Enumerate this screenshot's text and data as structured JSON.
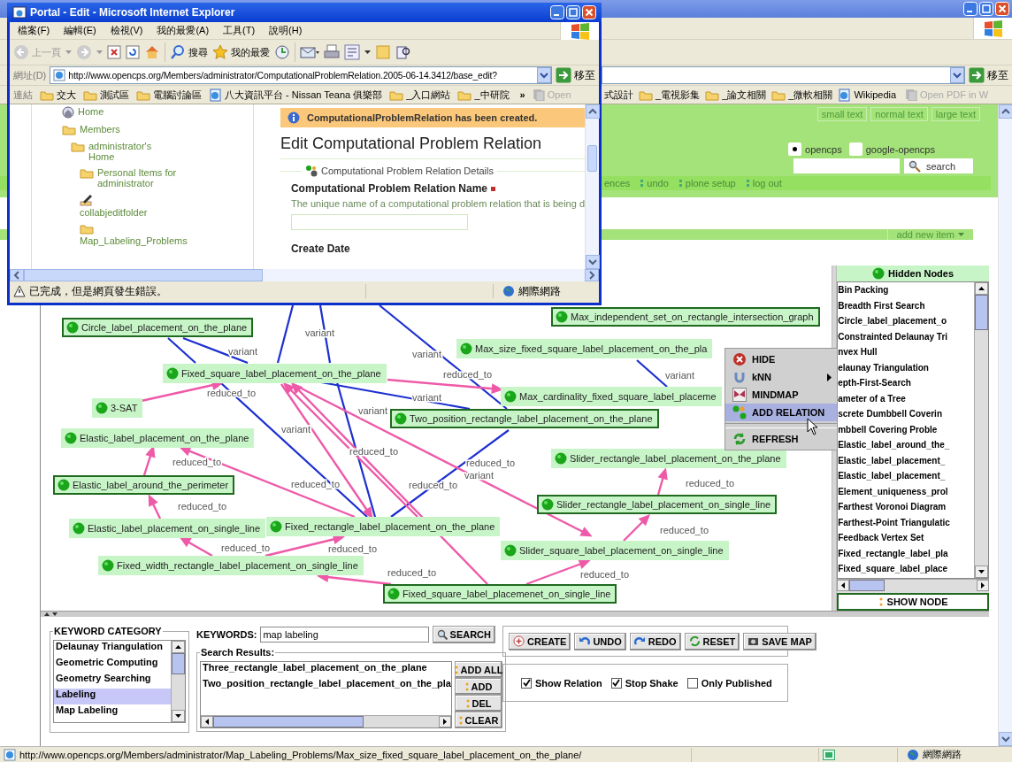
{
  "main_window": {
    "links": [
      {
        "label": "式設計",
        "kind": "folder_cut"
      },
      {
        "label": "_電視影集",
        "kind": "folder"
      },
      {
        "label": "_論文相關",
        "kind": "folder"
      },
      {
        "label": "_微軟相關",
        "kind": "folder"
      },
      {
        "label": "Wikipedia",
        "kind": "page"
      },
      {
        "label": "Open PDF in W",
        "kind": "disabled"
      }
    ],
    "go_button": "移至",
    "page": {
      "text_sizes": [
        "small text",
        "normal text",
        "large text"
      ],
      "search_scopes": [
        {
          "label": "opencps",
          "selected": true
        },
        {
          "label": "google-opencps",
          "selected": false
        }
      ],
      "search_button": "search",
      "nav_items": [
        "ences",
        "undo",
        "plone setup",
        "log out"
      ],
      "add_menu": "add new item"
    },
    "status_bar": {
      "url": "http://www.opencps.org/Members/administrator/Map_Labeling_Problems/Max_size_fixed_square_label_placement_on_the_plane/",
      "zone": "網際網路"
    }
  },
  "popup_window": {
    "title": "Portal - Edit - Microsoft Internet Explorer",
    "menu": [
      "檔案(F)",
      "編輯(E)",
      "檢視(V)",
      "我的最愛(A)",
      "工具(T)",
      "說明(H)"
    ],
    "toolbar": [
      {
        "label": "上一頁",
        "disabled": true
      },
      {
        "label": "搜尋",
        "disabled": false
      },
      {
        "label": "我的最愛",
        "disabled": false
      }
    ],
    "address_label": "網址(D)",
    "url": "http://www.opencps.org/Members/administrator/ComputationalProblemRelation.2005-06-14.3412/base_edit?",
    "go_button": "移至",
    "links_label": "連結",
    "links": [
      {
        "label": "交大",
        "kind": "folder"
      },
      {
        "label": "測試區",
        "kind": "folder"
      },
      {
        "label": "電腦討論區",
        "kind": "folder"
      },
      {
        "label": "八大資訊平台 - Nissan Teana 俱樂部",
        "kind": "page"
      },
      {
        "label": "_入口網站",
        "kind": "folder"
      },
      {
        "label": "_中研院",
        "kind": "folder"
      }
    ],
    "links_more": "»",
    "links_cut": "Open",
    "nav": [
      {
        "label": "Home",
        "kind": "home"
      },
      {
        "label": "Members",
        "kind": "folder",
        "children": [
          {
            "label": "administrator's Home",
            "kind": "folder",
            "children": [
              {
                "label": "Personal Items for administrator",
                "kind": "folder"
              },
              {
                "label": "collabjeditfolder",
                "kind": "edit_stacked"
              },
              {
                "label": "Map_Labeling_Problems",
                "kind": "folder_stacked"
              }
            ]
          }
        ]
      }
    ],
    "message": "ComputationalProblemRelation has been created.",
    "heading": "Edit Computational Problem Relation",
    "fieldset": "Computational Problem Relation Details",
    "field_label": "Computational Problem Relation Name",
    "required": true,
    "field_help": "The unique name of a computational problem relation that is being d",
    "next_label": "Create Date",
    "status": "已完成，但是網頁發生錯誤。",
    "zone": "網際網路"
  },
  "graph": {
    "nodes": [
      {
        "label": "Max_independent_set_on_rectangle_intersection_graph",
        "outlined": true
      },
      {
        "label": "Circle_label_placement_on_the_plane",
        "outlined": true
      },
      {
        "label": "Max_size_fixed_square_label_placement_on_the_pla",
        "outlined": false
      },
      {
        "label": "Fixed_square_label_placement_on_the_plane",
        "outlined": false
      },
      {
        "label": "Max_cardinality_fixed_square_label_placeme",
        "outlined": false
      },
      {
        "label": "3-SAT",
        "outlined": false
      },
      {
        "label": "Two_position_rectangle_label_placement_on_the_plane",
        "outlined": true
      },
      {
        "label": "Elastic_label_placement_on_the_plane",
        "outlined": false
      },
      {
        "label": "Slider_rectangle_label_placement_on_the_plane",
        "outlined": false
      },
      {
        "label": "Elastic_label_around_the_perimeter",
        "outlined": true
      },
      {
        "label": "Slider_rectangle_label_placement_on_single_line",
        "outlined": true
      },
      {
        "label": "Elastic_label_placement_on_single_line",
        "outlined": false
      },
      {
        "label": "Fixed_rectangle_label_placement_on_the_plane",
        "outlined": false
      },
      {
        "label": "Slider_square_label_placement_on_single_line",
        "outlined": false
      },
      {
        "label": "Fixed_width_rectangle_label_placement_on_single_line",
        "outlined": false
      },
      {
        "label": "Fixed_square_label_placemenet_on_single_line",
        "outlined": true
      }
    ],
    "edges": [
      {
        "kind": "variant"
      },
      {
        "kind": "variant",
        "label": "variant"
      },
      {
        "kind": "variant",
        "label": "variant"
      },
      {
        "kind": "variant"
      },
      {
        "kind": "variant",
        "label": "variant"
      },
      {
        "kind": "variant",
        "label": "variant"
      },
      {
        "kind": "variant",
        "label": "variant"
      },
      {
        "kind": "variant",
        "label": "variant"
      },
      {
        "kind": "variant",
        "label": "variant"
      },
      {
        "kind": "variant",
        "label": "variant"
      },
      {
        "kind": "reduced_to",
        "label": "reduced_to"
      },
      {
        "kind": "reduced_to",
        "label": "reduced_to"
      },
      {
        "kind": "reduced_to",
        "label": "reduced_to"
      },
      {
        "kind": "reduced_to",
        "label": "reduced_to"
      },
      {
        "kind": "reduced_to",
        "label": "reduced_to"
      },
      {
        "kind": "reduced_to",
        "label": "reduced_to"
      },
      {
        "kind": "reduced_to",
        "label": "reduced_to"
      },
      {
        "kind": "reduced_to",
        "label": "reduced_to"
      },
      {
        "kind": "reduced_to",
        "label": "reduced_to"
      },
      {
        "kind": "reduced_to",
        "label": "reduced_to"
      },
      {
        "kind": "reduced_to",
        "label": "reduced_to"
      },
      {
        "kind": "reduced_to"
      },
      {
        "kind": "reduced_to",
        "label": "reduced_to"
      },
      {
        "kind": "reduced_to",
        "label": "reduced_to"
      },
      {
        "kind": "reduced_to",
        "label": "reduced_to"
      }
    ],
    "context_menu": [
      {
        "label": "HIDE",
        "kind": "hide",
        "selected": false,
        "submenu": false
      },
      {
        "label": "kNN",
        "kind": "knn",
        "selected": false,
        "submenu": true
      },
      {
        "label": "MINDMAP",
        "kind": "mindmap",
        "selected": false,
        "submenu": false
      },
      {
        "label": "ADD RELATION",
        "kind": "relation",
        "selected": true,
        "submenu": false
      },
      {
        "label": "REFRESH",
        "kind": "refresh",
        "selected": false,
        "submenu": false
      }
    ]
  },
  "hidden_nodes": {
    "title": "Hidden Nodes",
    "items": [
      "Bin Packing",
      "Breadth First Search",
      "Circle_label_placement_o",
      "Constrainted Delaunay Tri",
      "nvex Hull",
      "elaunay Triangulation",
      "epth-First-Search",
      "ameter of a Tree",
      "screte Dumbbell Coverin",
      "mbbell Covering Proble",
      "Elastic_label_around_the_",
      "Elastic_label_placement_",
      "Elastic_label_placement_",
      "Element_uniqueness_prol",
      "Farthest Voronoi Diagram",
      "Farthest-Point Triangulatic",
      "Feedback Vertex Set",
      "Fixed_rectangle_label_pla",
      "Fixed_square_label_place"
    ],
    "show_button": "SHOW NODE"
  },
  "keyword_category": {
    "title": "KEYWORD CATEGORY",
    "items": [
      {
        "label": "Delaunay Triangulation",
        "selected": false
      },
      {
        "label": "Geometric Computing",
        "selected": false
      },
      {
        "label": "Geometry Searching",
        "selected": false
      },
      {
        "label": "Labeling",
        "selected": true
      },
      {
        "label": "Map Labeling",
        "selected": false
      }
    ]
  },
  "keywords": {
    "label": "KEYWORDS:",
    "value": "map labeling",
    "button": "SEARCH"
  },
  "search_results": {
    "title": "Search Results:",
    "items": [
      "Three_rectangle_label_placement_on_the_plane",
      "Two_position_rectangle_label_placement_on_the_pla"
    ],
    "buttons": [
      "ADD ALL",
      "ADD",
      "DEL",
      "CLEAR"
    ]
  },
  "actions": [
    {
      "label": "CREATE",
      "kind": "create"
    },
    {
      "label": "UNDO",
      "kind": "undo"
    },
    {
      "label": "REDO",
      "kind": "redo"
    },
    {
      "label": "RESET",
      "kind": "reset"
    },
    {
      "label": "SAVE MAP",
      "kind": "save"
    }
  ],
  "options": [
    {
      "label": "Show Relation",
      "checked": true
    },
    {
      "label": "Stop Shake",
      "checked": true
    },
    {
      "label": "Only Published",
      "checked": false
    }
  ]
}
